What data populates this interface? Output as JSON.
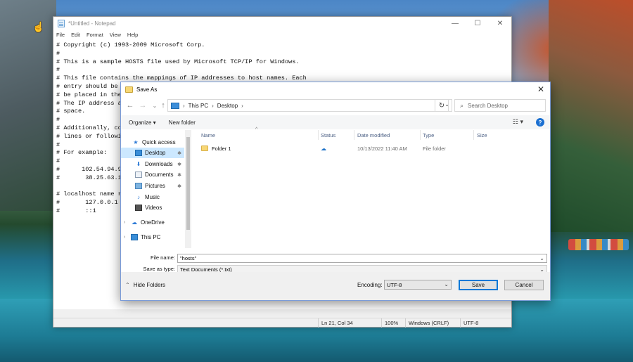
{
  "notepad": {
    "title": "*Untitled - Notepad",
    "menu": [
      "File",
      "Edit",
      "Format",
      "View",
      "Help"
    ],
    "lines": [
      "# Copyright (c) 1993-2009 Microsoft Corp.",
      "#",
      "# This is a sample HOSTS file used by Microsoft TCP/IP for Windows.",
      "#",
      "# This file contains the mappings of IP addresses to host names. Each",
      "# entry should be",
      "# be placed in the",
      "# The IP address a",
      "# space.",
      "#",
      "# Additionally, co",
      "# lines or followi",
      "#",
      "# For example:",
      "#",
      "#      102.54.94.9",
      "#       38.25.63.1",
      "",
      "# localhost name r",
      "#       127.0.0.1",
      "#       ::1"
    ],
    "status": {
      "position": "Ln 21, Col 34",
      "zoom": "100%",
      "line_ending": "Windows (CRLF)",
      "encoding": "UTF-8"
    }
  },
  "dialog": {
    "title": "Save As",
    "address": [
      "This PC",
      "Desktop"
    ],
    "search_placeholder": "Search Desktop",
    "toolbar": {
      "organize": "Organize ▾",
      "new_folder": "New folder"
    },
    "nav": {
      "quick_access": "Quick access",
      "desktop": "Desktop",
      "downloads": "Downloads",
      "documents": "Documents",
      "pictures": "Pictures",
      "music": "Music",
      "videos": "Videos",
      "onedrive": "OneDrive",
      "this_pc": "This PC"
    },
    "columns": {
      "name": "Name",
      "status": "Status",
      "date_modified": "Date modified",
      "type": "Type",
      "size": "Size"
    },
    "files": [
      {
        "name": "Folder 1",
        "date_modified": "10/13/2022 11:40 AM",
        "type": "File folder",
        "size": ""
      }
    ],
    "file_name_label": "File name:",
    "file_name_value": "\"hosts\"",
    "save_as_type_label": "Save as type:",
    "save_as_type_value": "Text Documents (*.txt)",
    "hide_folders": "Hide Folders",
    "encoding_label": "Encoding:",
    "encoding_value": "UTF-8",
    "save": "Save",
    "cancel": "Cancel"
  }
}
